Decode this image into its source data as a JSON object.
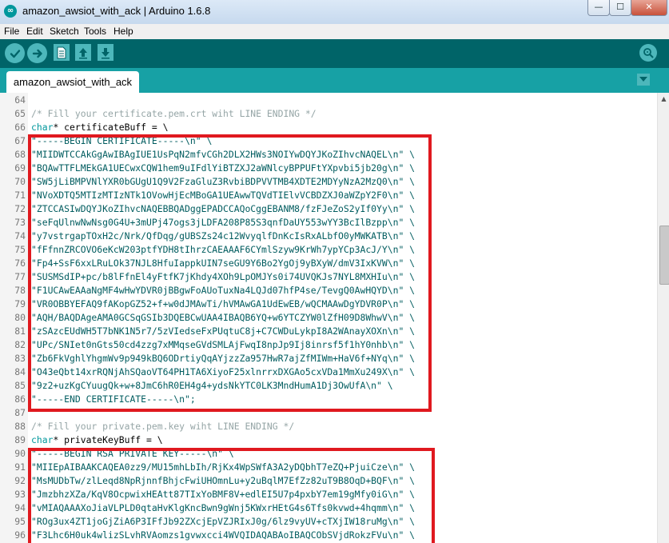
{
  "window": {
    "title": "amazon_awsiot_with_ack | Arduino 1.6.8",
    "app_icon": "arduino-logo-icon",
    "controls": {
      "minimize": "—",
      "maximize": "☐",
      "close": "✕"
    }
  },
  "menu": [
    "File",
    "Edit",
    "Sketch",
    "Tools",
    "Help"
  ],
  "toolbar": {
    "buttons": [
      "verify-icon",
      "upload-icon",
      "new-icon",
      "open-icon",
      "save-icon"
    ],
    "serial_monitor": "serial-monitor-icon"
  },
  "tabs": [
    {
      "label": "amazon_awsiot_with_ack"
    }
  ],
  "tab_menu_icon": "dropdown-arrow-icon",
  "editor": {
    "lines": [
      {
        "n": "64",
        "text": ""
      },
      {
        "n": "65",
        "text": "/* Fill your certificate.pem.crt wiht LINE ENDING */",
        "kind": "comment"
      },
      {
        "n": "66",
        "kw": "char",
        "text": "* certificateBuff = \\"
      },
      {
        "n": "67",
        "text": "\"-----BEGIN CERTIFICATE-----\\n\" \\"
      },
      {
        "n": "68",
        "text": "\"MIIDWTCCAkGgAwIBAgIUE1UsPqN2mfvCGh2DLX2HWs3NOIYwDQYJKoZIhvcNAQEL\\n\" \\"
      },
      {
        "n": "69",
        "text": "\"BQAwTTFLMEkGA1UECwxCQW1hem9uIFdlYiBTZXJ2aWNlcyBPPUFtYXpvbi5jb20g\\n\" \\"
      },
      {
        "n": "70",
        "text": "\"SW5jLiBMPVNlYXR0bGUgU1Q9V2FzaGluZ3RvbiBDPVVTMB4XDTE2MDYyNzA2MzQ0\\n\" \\"
      },
      {
        "n": "71",
        "text": "\"NVoXDTQ5MTIzMTIzNTk1OVowHjEcMBoGA1UEAwwTQVdTIElvVCBDZXJ0aWZpY2F0\\n\" \\"
      },
      {
        "n": "72",
        "text": "\"ZTCCASIwDQYJKoZIhvcNAQEBBQADggEPADCCAQoCggEBANM8/fzFJeZoS2yIf0Yy\\n\" \\"
      },
      {
        "n": "73",
        "text": "\"seFqUlnwNwNsg0G4U+3mUPj47ogs3jLDFA208P85S3qnfDaUY553wYY3BcIlBzpp\\n\" \\"
      },
      {
        "n": "74",
        "text": "\"y7vstrgapTOxH2c/Nrk/QfDqg/gUBSZs24c12WvyqlfDnKcIsRxALbfO0yMWKATB\\n\" \\"
      },
      {
        "n": "75",
        "text": "\"fFfnnZRCOVO6eKcW203ptfYDH8tIhrzCAEAAAF6CYmlSzyw9KrWh7ypYCp3AcJ/Y\\n\" \\"
      },
      {
        "n": "76",
        "text": "\"Fp4+SsF6xxLRuLOk37NJL8HfuIappkUIN7seGU9Y6Bo2YgOj9yBXyW/dmV3IxKVW\\n\" \\"
      },
      {
        "n": "77",
        "text": "\"SUSMSdIP+pc/b8lFfnEl4yFtfK7jKhdy4XOh9LpOMJYs0i74UVQKJs7NYL8MXHIu\\n\" \\"
      },
      {
        "n": "78",
        "text": "\"F1UCAwEAAaNgMF4wHwYDVR0jBBgwFoAUoTuxNa4LQJd07hfP4se/TevgQ0AwHQYD\\n\" \\"
      },
      {
        "n": "79",
        "text": "\"VR0OBBYEFAQ9fAKopGZ52+f+w0dJMAwTi/hVMAwGA1UdEwEB/wQCMAAwDgYDVR0P\\n\" \\"
      },
      {
        "n": "80",
        "text": "\"AQH/BAQDAgeAMA0GCSqGSIb3DQEBCwUAA4IBAQB6YQ+w6YTCZYW0lZfH09D8WhwV\\n\" \\"
      },
      {
        "n": "81",
        "text": "\"zSAzcEUdWH5T7bNK1N5r7/5zVIedseFxPUqtuC8j+C7CWDuLykpI8A2WAnayXOXn\\n\" \\"
      },
      {
        "n": "82",
        "text": "\"UPc/SNIet0nGts50cd4zzg7xMMqseGVdSMLAjFwqI8npJp9Ij8inrsf5f1hY0nhb\\n\" \\"
      },
      {
        "n": "83",
        "text": "\"Zb6FkVghlYhgmWv9p949kBQ6ODrtiyQqAYjzzZa957HwR7ajZfMIWm+HaV6f+NYq\\n\" \\"
      },
      {
        "n": "84",
        "text": "\"O43eQbt14xrRQNjAhSQaoVT64PH1TA6XiyoF25xlnrrxDXGAo5cxVDa1MmXu249X\\n\" \\"
      },
      {
        "n": "85",
        "text": "\"9z2+uzKgCYuugQk+w+8JmC6hR0EH4g4+ydsNkYTC0LK3MndHumA1Dj3OwUfA\\n\" \\"
      },
      {
        "n": "86",
        "text": "\"-----END CERTIFICATE-----\\n\";"
      },
      {
        "n": "87",
        "text": ""
      },
      {
        "n": "88",
        "text": "/* Fill your private.pem.key wiht LINE ENDING */",
        "kind": "comment"
      },
      {
        "n": "89",
        "kw": "char",
        "text": "* privateKeyBuff = \\"
      },
      {
        "n": "90",
        "text": "\"-----BEGIN RSA PRIVATE KEY-----\\n\" \\"
      },
      {
        "n": "91",
        "text": "\"MIIEpAIBAAKCAQEA0zz9/MU15mhLbIh/RjKx4WpSWfA3A2yDQbhT7eZQ+PjuiCze\\n\" \\"
      },
      {
        "n": "92",
        "text": "\"MsMUDbTw/zlLeqd8NpRjnnfBhjcFwiUHOmnLu+y2uBqlM7EfZz82uT9B8OqD+BQF\\n\" \\"
      },
      {
        "n": "93",
        "text": "\"JmzbhzXZa/KqV8OcpwixHEAtt87TIxYoBMF8V+edlEI5U7p4pxbY7em19gMfy0iG\\n\" \\"
      },
      {
        "n": "94",
        "text": "\"vMIAQAAAXoJiaVLPLD0qtaHvKlgKncBwn9gWnj5KWxrHEtG4s6Tfs0kvwd+4hqmm\\n\" \\"
      },
      {
        "n": "95",
        "text": "\"ROg3ux4ZT1joGjZiA6P3IFfJb92ZXcjEpVZJRIxJ0g/6lz9vyUV+cTXjIW18ruMg\\n\" \\"
      },
      {
        "n": "96",
        "text": "\"F3Lhc6H0uk4wlizSLvhRVAomzs1gvwxcci4WVQIDAQABAoIBAQCObSVjdRokzFVu\\n\" \\"
      }
    ]
  },
  "colors": {
    "toolbar": "#006468",
    "tabbar": "#17a1a5",
    "highlight_box": "#e0191f",
    "keyword": "#00979c",
    "comment": "#95a5a6"
  }
}
